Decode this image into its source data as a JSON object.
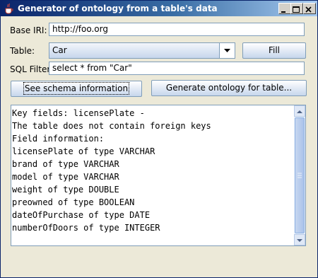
{
  "window": {
    "title": "Generator of ontology from a table's data"
  },
  "base_iri": {
    "label": "Base IRI:",
    "value": "http://foo.org"
  },
  "table": {
    "label": "Table:",
    "selected": "Car",
    "fill_button": "Fill"
  },
  "sql_filter": {
    "label": "SQL Filter:",
    "value": "select * from \"Car\""
  },
  "buttons": {
    "schema": "See schema information",
    "generate": "Generate ontology for table..."
  },
  "output": {
    "lines": [
      "Key fields: licensePlate -",
      "The table does not contain foreign keys",
      "Field information:",
      "licensePlate of type VARCHAR",
      "brand of type VARCHAR",
      "model of type VARCHAR",
      "weight of type DOUBLE",
      "preowned of type BOOLEAN",
      "dateOfPurchase of type DATE",
      "numberOfDoors of type INTEGER"
    ]
  },
  "icons": {
    "app": "java-cup-icon",
    "minimize": "minimize-icon",
    "maximize": "maximize-icon",
    "close": "close-icon"
  }
}
